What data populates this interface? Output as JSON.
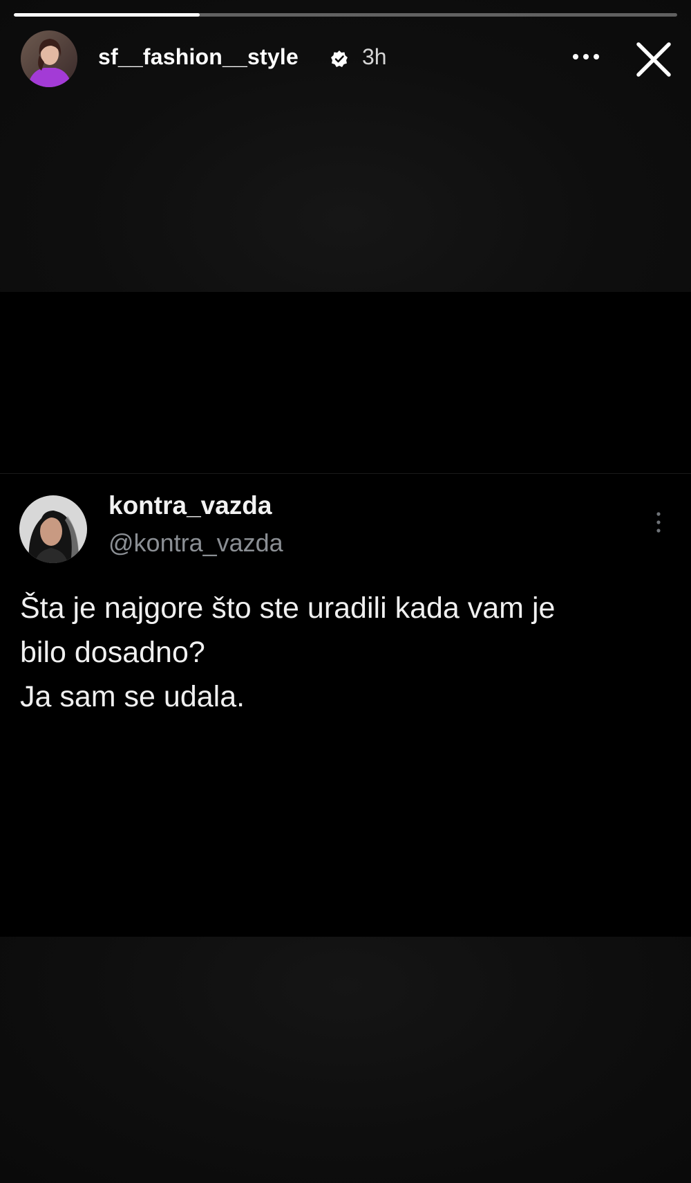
{
  "story": {
    "progress_fraction": 0.28,
    "username": "sf__fashion__style",
    "verified": true,
    "time_ago": "3h",
    "icons": {
      "avatar": "profile-photo",
      "verified": "verified-badge-icon",
      "more": "more-horizontal-icon",
      "close": "close-icon"
    }
  },
  "tweet": {
    "display_name": "kontra_vazda",
    "handle": "@kontra_vazda",
    "lines": [
      "Šta je najgore što ste uradili kada vam je",
      "bilo dosadno?",
      "Ja sam se udala."
    ],
    "icons": {
      "more": "more-vertical-icon"
    }
  },
  "colors": {
    "background": "#000000",
    "handle": "#8b8f94",
    "avatar_accent": "#a33bd6"
  }
}
